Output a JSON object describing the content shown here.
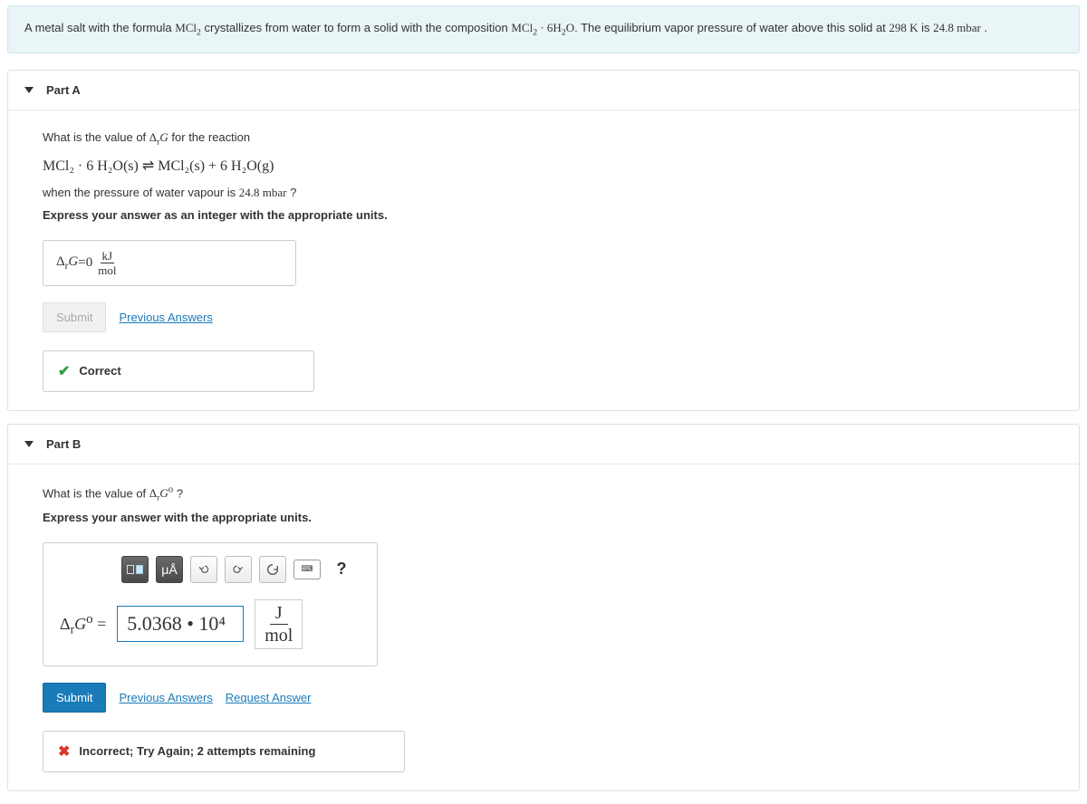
{
  "intro": {
    "pre": "A metal salt with the formula ",
    "f1": "MCl",
    "f1sub": "2",
    "mid1": " crystallizes from water to form a solid with the composition ",
    "f2a": "MCl",
    "f2asub": "2",
    "dot": " · ",
    "f2b": "6H",
    "f2bsub": "2",
    "f2c": "O",
    "mid2": ". The equilibrium vapor pressure of water above this solid at ",
    "temp": "298 K",
    "mid3": " is ",
    "press": "24.8  mbar",
    "end": " ."
  },
  "partA": {
    "title": "Part A",
    "q1a": "What is the value of ",
    "drg": "Δ",
    "drgsub": "r",
    "drg2": "G",
    "q1b": " for the reaction",
    "eq": "MCl₂ · 6 H₂O(s)  ⇌  MCl₂(s) + 6 H₂O(g)",
    "q2a": "when the pressure of water vapour is ",
    "q2press": "24.8  mbar",
    "q2b": " ?",
    "instr": "Express your answer as an integer with the appropriate units.",
    "ans_lhs_a": "Δ",
    "ans_lhs_sub": "r",
    "ans_lhs_b": "G",
    "ans_eq": " = ",
    "ans_val": "0",
    "ans_unit_num": "kJ",
    "ans_unit_den": "mol",
    "submit": "Submit",
    "prev": "Previous Answers",
    "feedback": "Correct"
  },
  "partB": {
    "title": "Part B",
    "q1a": "What is the value of ",
    "sym_a": "Δ",
    "sym_sub": "r",
    "sym_b": "G",
    "sym_sup": "o",
    "q1b": " ?",
    "instr": "Express your answer with the appropriate units.",
    "tool_units": "μÅ",
    "tool_help": "?",
    "lhs_a": "Δ",
    "lhs_sub": "r",
    "lhs_b": "G",
    "lhs_sup": "o",
    "lhs_eq": " = ",
    "value": "5.0368 • 10⁴",
    "unit_num": "J",
    "unit_den": "mol",
    "submit": "Submit",
    "prev": "Previous Answers",
    "req": "Request Answer",
    "feedback": "Incorrect; Try Again; 2 attempts remaining"
  }
}
